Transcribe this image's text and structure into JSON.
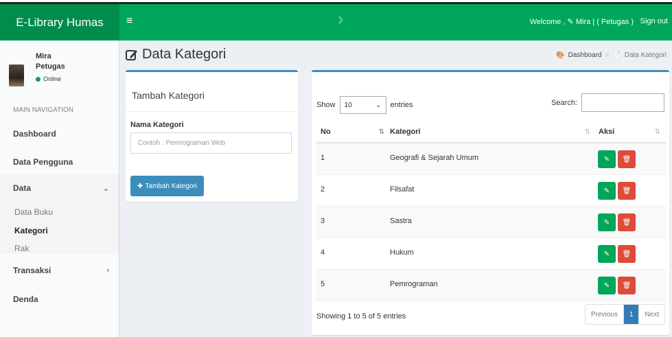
{
  "app": {
    "logo": "E-Library Humas"
  },
  "topbar": {
    "menu_icon": "≡",
    "loader": "☽",
    "welcome": "Welcome , ✎ Mira | ( Petugas )",
    "signout": "Sign out"
  },
  "user": {
    "name": "Mira",
    "role": "Petugas",
    "status": "Online"
  },
  "sidebar": {
    "header": "MAIN NAVIGATION",
    "dashboard": "Dashboard",
    "pengguna": "Data Pengguna",
    "data": "Data",
    "data_arrow": "⌄",
    "sub": [
      "Data Buku",
      "Kategori",
      "Rak"
    ],
    "transaksi": "Transaksi",
    "transaksi_arrow": "‹",
    "denda": "Denda"
  },
  "page": {
    "title": "Data Kategori",
    "breadcrumb": {
      "home": "Dashboard",
      "sep": ">",
      "current": "Data Kategori"
    }
  },
  "form": {
    "title": "Tambah Kategori",
    "label": "Nama Kategori",
    "placeholder": "Contoh : Pemrograman Web",
    "button": "Tambah Kategori"
  },
  "table": {
    "show": "Show",
    "entries_value": "10",
    "entries": "entries",
    "search": "Search:",
    "columns": [
      "No",
      "Kategori",
      "Aksi"
    ],
    "rows": [
      {
        "no": "1",
        "kategori": "Geografi & Sejarah Umum"
      },
      {
        "no": "2",
        "kategori": "Filsafat"
      },
      {
        "no": "3",
        "kategori": "Sastra"
      },
      {
        "no": "4",
        "kategori": "Hukum"
      },
      {
        "no": "5",
        "kategori": "Pemrograman"
      }
    ],
    "info": "Showing 1 to 5 of 5 entries",
    "pager": {
      "prev": "Previous",
      "page": "1",
      "next": "Next"
    }
  },
  "colors": {
    "header_green": "#00a65a",
    "logo_green": "#008d4c",
    "primary": "#3c8dbc",
    "danger": "#dd4b39"
  }
}
